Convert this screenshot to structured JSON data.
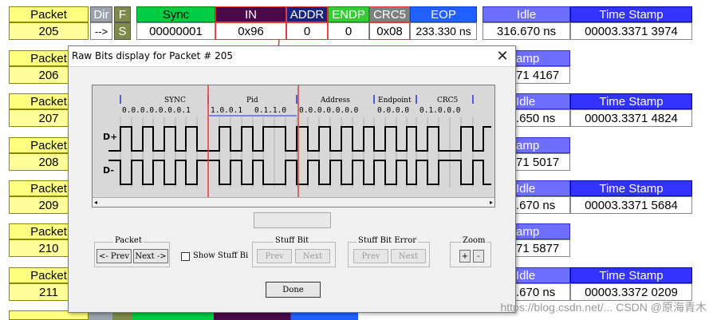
{
  "header": {
    "packet_label": "Packet",
    "packet_num": "205",
    "dir_label": "Dir",
    "dir_value": "-->",
    "f_label": "F",
    "f_value": "S",
    "sync_label": "Sync",
    "sync_value": "00000001",
    "in_label": "IN",
    "in_value": "0x96",
    "addr_label": "ADDR",
    "addr_value": "0",
    "endp_label": "ENDP",
    "endp_value": "0",
    "crc5_label": "CRC5",
    "crc5_value": "0x08",
    "eop_label": "EOP",
    "eop_value": "233.330 ns",
    "idle_label": "Idle",
    "idle_value": "316.670 ns",
    "ts_label": "Time Stamp",
    "ts_value": "00003.3371 3974"
  },
  "rows": [
    {
      "label": "Packet",
      "num": "206",
      "idle_label": "amp",
      "idle_val": "71 4167",
      "ts_label": "",
      "ts_val": ""
    },
    {
      "label": "Packet",
      "num": "207",
      "idle_label": "Idle",
      "idle_val": ".650 ns",
      "ts_label": "Time Stamp",
      "ts_val": "00003.3371 4824"
    },
    {
      "label": "Packet",
      "num": "208",
      "idle_label": "amp",
      "idle_val": "71 5017",
      "ts_label": "",
      "ts_val": ""
    },
    {
      "label": "Packet",
      "num": "209",
      "idle_label": "Idle",
      "idle_val": ".670 ns",
      "ts_label": "Time Stamp",
      "ts_val": "00003.3371 5684"
    },
    {
      "label": "Packet",
      "num": "210",
      "idle_label": "amp",
      "idle_val": "71 5877",
      "ts_label": "",
      "ts_val": ""
    },
    {
      "label": "Packet",
      "num": "211",
      "idle_label": "Idle",
      "idle_val": ".670 ns",
      "ts_label": "Time Stamp",
      "ts_val": "00003.3372 0209"
    }
  ],
  "dialog": {
    "title": "Raw Bits display for Packet # 205",
    "close": "✕",
    "fields": {
      "sync": "SYNC",
      "pid": "Pid",
      "address": "Address",
      "endpoint": "Endpoint",
      "crc5": "CRC5"
    },
    "bits": {
      "sync": "0.0.0.0.0.0.0.1",
      "pid_a": "1.0.0.1",
      "pid_b": "0.1.1.0",
      "address": "0.0.0.0.0.0.0",
      "endpoint": "0.0.0.0",
      "crc5": "0.1.0.0.0"
    },
    "dplus": "D+",
    "dminus": "D-",
    "packet_group": "Packet",
    "prev": "<- Prev",
    "next": "Next ->",
    "show_stuff": "Show Stuff Bi",
    "stuff_group": "Stuff Bit",
    "stuff_prev": "Prev",
    "stuff_next": "Next",
    "stuff_err_group": "Stuff Bit Error",
    "err_prev": "Prev",
    "err_next": "Next",
    "zoom_group": "Zoom",
    "zoom_in": "+",
    "zoom_out": "-",
    "done": "Done"
  },
  "watermark": "https://blog.csdn.net/... CSDN @原海青木",
  "colors": {
    "highlight": "#e53935",
    "packet_yellow": "#ffff80",
    "dir_gray": "#9aa3ad",
    "f_green": "#7d8a4a",
    "sync_green": "#00cc44",
    "in_purple": "#4a0a4a",
    "addr_navy": "#1a237e",
    "endp_green": "#33cc33",
    "crc5_gray": "#808080",
    "eop_blue": "#2060ff",
    "idle_blue": "#6f6fff",
    "ts_blue": "#3333ff"
  }
}
